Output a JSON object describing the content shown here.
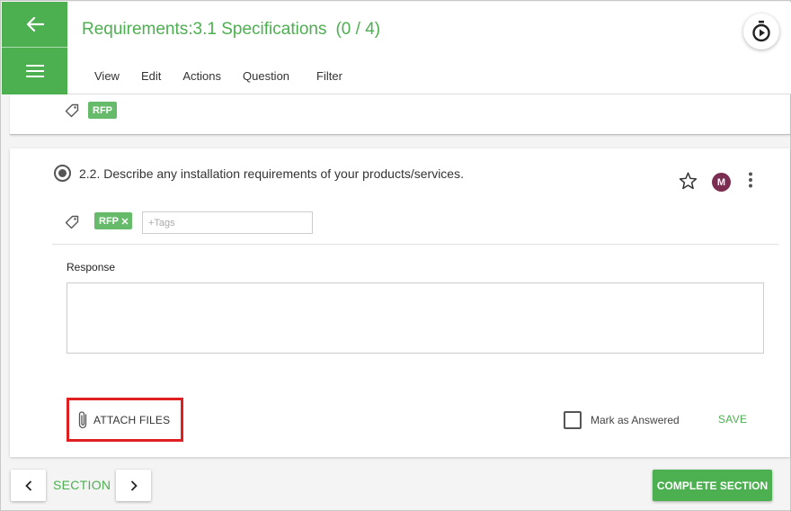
{
  "header": {
    "title": "Requirements:3.1 Specifications",
    "count": "(0 / 4)",
    "back_icon": "arrow-left-icon",
    "menu_icon": "hamburger-menu-icon",
    "timer_icon": "stopwatch-icon",
    "menu": [
      "View",
      "Edit",
      "Actions",
      "Question",
      "Filter"
    ]
  },
  "prev_card": {
    "tag": "RFP"
  },
  "question": {
    "text": "2.2. Describe any installation requirements of your products/services.",
    "avatar_initial": "M",
    "tag": "RFP",
    "tags_placeholder": "+Tags",
    "response_label": "Response",
    "response_value": "",
    "attach_label": "ATTACH FILES",
    "mark_answered_label": "Mark as Answered",
    "save_label": "SAVE"
  },
  "footer": {
    "section_label": "SECTION",
    "complete_label": "COMPLETE SECTION"
  },
  "colors": {
    "accent": "#4caf50",
    "avatar": "#7b2d52",
    "highlight": "#e02020"
  }
}
